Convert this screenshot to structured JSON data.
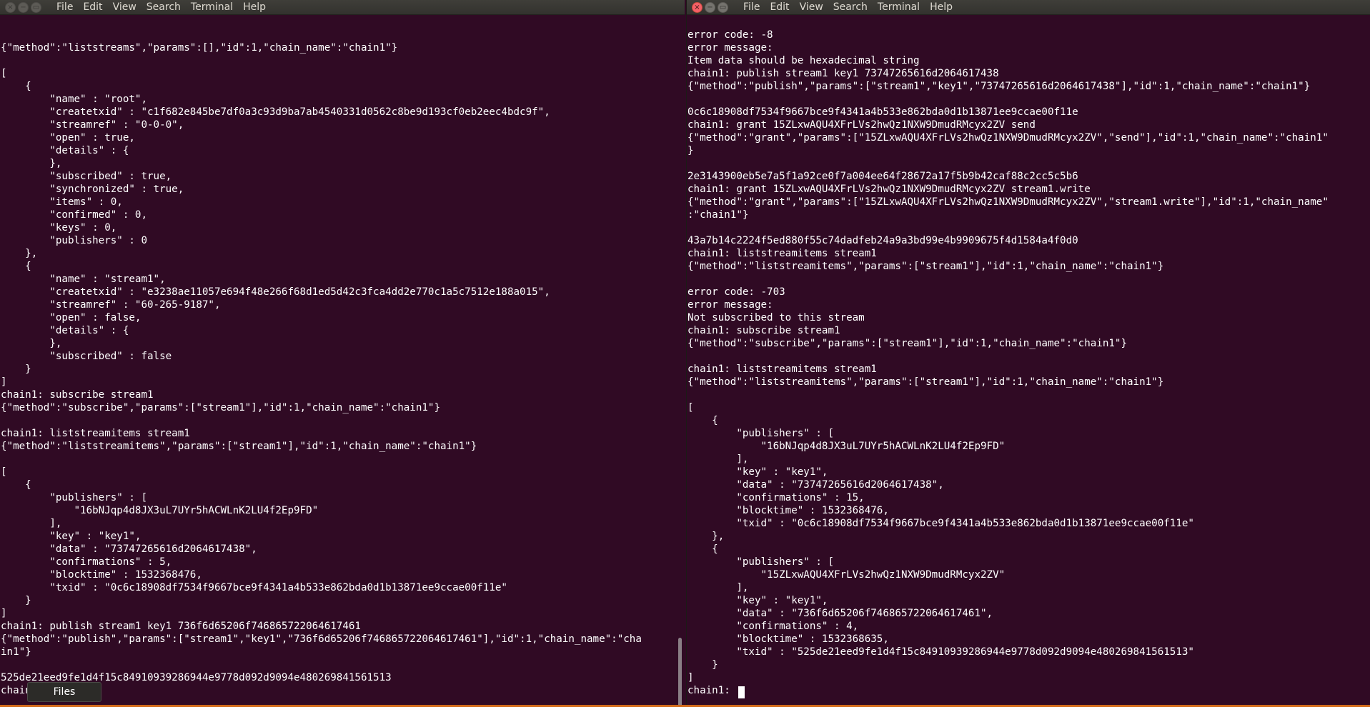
{
  "left_window": {
    "menu": [
      "File",
      "Edit",
      "View",
      "Search",
      "Terminal",
      "Help"
    ],
    "lines": [
      "",
      "",
      "{\"method\":\"liststreams\",\"params\":[],\"id\":1,\"chain_name\":\"chain1\"}",
      "",
      "[",
      "    {",
      "        \"name\" : \"root\",",
      "        \"createtxid\" : \"c1f682e845be7df0a3c93d9ba7ab4540331d0562c8be9d193cf0eb2eec4bdc9f\",",
      "        \"streamref\" : \"0-0-0\",",
      "        \"open\" : true,",
      "        \"details\" : {",
      "        },",
      "        \"subscribed\" : true,",
      "        \"synchronized\" : true,",
      "        \"items\" : 0,",
      "        \"confirmed\" : 0,",
      "        \"keys\" : 0,",
      "        \"publishers\" : 0",
      "    },",
      "    {",
      "        \"name\" : \"stream1\",",
      "        \"createtxid\" : \"e3238ae11057e694f48e266f68d1ed5d42c3fca4dd2e770c1a5c7512e188a015\",",
      "        \"streamref\" : \"60-265-9187\",",
      "        \"open\" : false,",
      "        \"details\" : {",
      "        },",
      "        \"subscribed\" : false",
      "    }",
      "]",
      "chain1: subscribe stream1",
      "{\"method\":\"subscribe\",\"params\":[\"stream1\"],\"id\":1,\"chain_name\":\"chain1\"}",
      "",
      "chain1: liststreamitems stream1",
      "{\"method\":\"liststreamitems\",\"params\":[\"stream1\"],\"id\":1,\"chain_name\":\"chain1\"}",
      "",
      "[",
      "    {",
      "        \"publishers\" : [",
      "            \"16bNJqp4d8JX3uL7UYr5hACWLnK2LU4f2Ep9FD\"",
      "        ],",
      "        \"key\" : \"key1\",",
      "        \"data\" : \"73747265616d2064617438\",",
      "        \"confirmations\" : 5,",
      "        \"blocktime\" : 1532368476,",
      "        \"txid\" : \"0c6c18908df7534f9667bce9f4341a4b533e862bda0d1b13871ee9ccae00f11e\"",
      "    }",
      "]",
      "chain1: publish stream1 key1 736f6d65206f746865722064617461",
      "{\"method\":\"publish\",\"params\":[\"stream1\",\"key1\",\"736f6d65206f746865722064617461\"],\"id\":1,\"chain_name\":\"cha",
      "in1\"}",
      "",
      "525de21eed9fe1d4f15c84910939286944e9778d092d9094e480269841561513",
      "chain1: "
    ]
  },
  "right_window": {
    "menu": [
      "File",
      "Edit",
      "View",
      "Search",
      "Terminal",
      "Help"
    ],
    "lines": [
      "",
      "error code: -8",
      "error message:",
      "Item data should be hexadecimal string",
      "chain1: publish stream1 key1 73747265616d2064617438",
      "{\"method\":\"publish\",\"params\":[\"stream1\",\"key1\",\"73747265616d2064617438\"],\"id\":1,\"chain_name\":\"chain1\"}",
      "",
      "0c6c18908df7534f9667bce9f4341a4b533e862bda0d1b13871ee9ccae00f11e",
      "chain1: grant 15ZLxwAQU4XFrLVs2hwQz1NXW9DmudRMcyx2ZV send",
      "{\"method\":\"grant\",\"params\":[\"15ZLxwAQU4XFrLVs2hwQz1NXW9DmudRMcyx2ZV\",\"send\"],\"id\":1,\"chain_name\":\"chain1\"",
      "}",
      "",
      "2e3143900eb5e7a5f1a92ce0f7a004ee64f28672a17f5b9b42caf88c2cc5c5b6",
      "chain1: grant 15ZLxwAQU4XFrLVs2hwQz1NXW9DmudRMcyx2ZV stream1.write",
      "{\"method\":\"grant\",\"params\":[\"15ZLxwAQU4XFrLVs2hwQz1NXW9DmudRMcyx2ZV\",\"stream1.write\"],\"id\":1,\"chain_name\"",
      ":\"chain1\"}",
      "",
      "43a7b14c2224f5ed880f55c74dadfeb24a9a3bd99e4b9909675f4d1584a4f0d0",
      "chain1: liststreamitems stream1",
      "{\"method\":\"liststreamitems\",\"params\":[\"stream1\"],\"id\":1,\"chain_name\":\"chain1\"}",
      "",
      "error code: -703",
      "error message:",
      "Not subscribed to this stream",
      "chain1: subscribe stream1",
      "{\"method\":\"subscribe\",\"params\":[\"stream1\"],\"id\":1,\"chain_name\":\"chain1\"}",
      "",
      "chain1: liststreamitems stream1",
      "{\"method\":\"liststreamitems\",\"params\":[\"stream1\"],\"id\":1,\"chain_name\":\"chain1\"}",
      "",
      "[",
      "    {",
      "        \"publishers\" : [",
      "            \"16bNJqp4d8JX3uL7UYr5hACWLnK2LU4f2Ep9FD\"",
      "        ],",
      "        \"key\" : \"key1\",",
      "        \"data\" : \"73747265616d2064617438\",",
      "        \"confirmations\" : 15,",
      "        \"blocktime\" : 1532368476,",
      "        \"txid\" : \"0c6c18908df7534f9667bce9f4341a4b533e862bda0d1b13871ee9ccae00f11e\"",
      "    },",
      "    {",
      "        \"publishers\" : [",
      "            \"15ZLxwAQU4XFrLVs2hwQz1NXW9DmudRMcyx2ZV\"",
      "        ],",
      "        \"key\" : \"key1\",",
      "        \"data\" : \"736f6d65206f746865722064617461\",",
      "        \"confirmations\" : 4,",
      "        \"blocktime\" : 1532368635,",
      "        \"txid\" : \"525de21eed9fe1d4f15c84910939286944e9778d092d9094e480269841561513\"",
      "    }",
      "]",
      "chain1: "
    ]
  },
  "tooltip": {
    "label": "Files"
  },
  "colors": {
    "terminal_bg": "#300a24",
    "terminal_fg": "#ffffff",
    "titlebar": "#3c3b37",
    "close_button": "#f46067"
  }
}
